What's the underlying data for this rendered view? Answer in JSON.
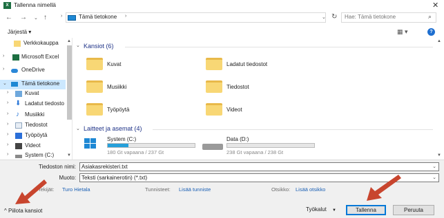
{
  "window": {
    "title": "Tallenna nimellä",
    "app_icon": "excel-icon"
  },
  "address": {
    "path_root": "Tämä tietokone",
    "search_placeholder": "Hae: Tämä tietokone"
  },
  "toolbar": {
    "organize": "Järjestä"
  },
  "sidebar": {
    "items": [
      {
        "label": "Verkkokauppa",
        "icon": "folder-icon"
      },
      {
        "label": "Microsoft Excel",
        "icon": "excel-icon"
      },
      {
        "label": "OneDrive",
        "icon": "cloud-icon"
      },
      {
        "label": "Tämä tietokone",
        "icon": "computer-icon"
      },
      {
        "label": "Kuvat",
        "icon": "pictures-icon"
      },
      {
        "label": "Ladatut tiedosto",
        "icon": "download-icon"
      },
      {
        "label": "Musiikki",
        "icon": "music-icon"
      },
      {
        "label": "Tiedostot",
        "icon": "documents-icon"
      },
      {
        "label": "Työpöytä",
        "icon": "desktop-icon"
      },
      {
        "label": "Videot",
        "icon": "video-icon"
      },
      {
        "label": "System (C:)",
        "icon": "drive-icon"
      }
    ]
  },
  "folders": {
    "header": "Kansiot (6)",
    "items": [
      {
        "label": "Kuvat"
      },
      {
        "label": "Ladatut tiedostot"
      },
      {
        "label": "Musiikki"
      },
      {
        "label": "Tiedostot"
      },
      {
        "label": "Työpöytä"
      },
      {
        "label": "Videot"
      }
    ]
  },
  "devices": {
    "header": "Laitteet ja asemat (4)",
    "items": [
      {
        "label": "System (C:)",
        "free": "180 Gt vapaana / 237 Gt",
        "used_fraction": 0.24
      },
      {
        "label": "Data (D:)",
        "free": "238 Gt vapaana / 238 Gt",
        "used_fraction": 0.0
      }
    ]
  },
  "form": {
    "filename_label": "Tiedoston nimi:",
    "filename_value": "Asiakasrekisteri.txt",
    "type_label": "Muoto:",
    "type_value": "Teksti (sarkainerotin) (*.txt)",
    "author_label": "Tekijät:",
    "author_value": "Turo Hietala",
    "tags_label": "Tunnisteet:",
    "tags_value": "Lisää tunniste",
    "title_label": "Otsikko:",
    "title_value": "Lisää otsikko"
  },
  "footer": {
    "hide_folders": "Piilota kansiot",
    "tools": "Työkalut",
    "save": "Tallenna",
    "cancel": "Peruuta"
  },
  "colors": {
    "accent": "#0078d7",
    "annotation_arrow": "#c8452e",
    "selection": "#cce8ff"
  }
}
